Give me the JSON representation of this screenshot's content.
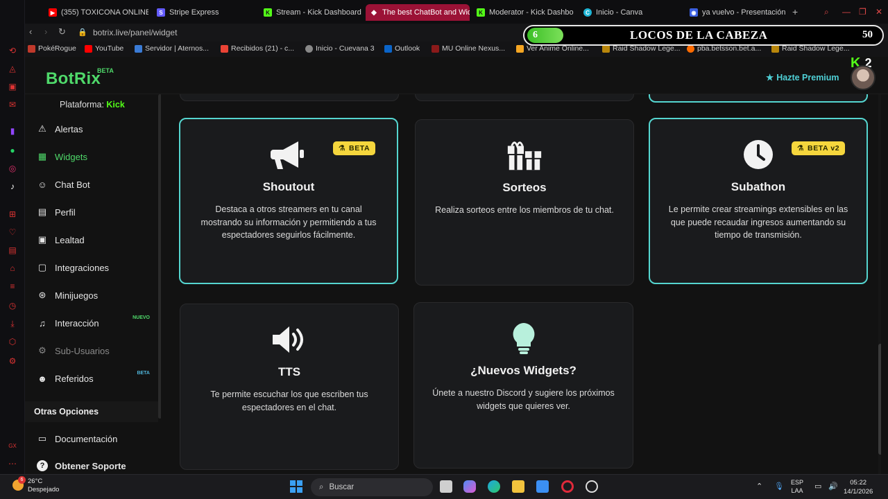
{
  "browser": {
    "tabs": [
      {
        "label": "(355) TOXICONA ONLINE",
        "favicon_color": "#ff0000",
        "favicon_glyph": "▶"
      },
      {
        "label": "Stripe Express",
        "favicon_color": "#635bff",
        "favicon_glyph": "S"
      },
      {
        "label": "Stream - Kick Dashboard",
        "favicon_color": "#53fc18",
        "favicon_glyph": "K"
      },
      {
        "label": "The best ChatBot and Wid",
        "favicon_color": "#ffffff",
        "favicon_glyph": "◆"
      },
      {
        "label": "Moderator - Kick Dashbo",
        "favicon_color": "#53fc18",
        "favicon_glyph": "K"
      },
      {
        "label": "Inicio - Canva",
        "favicon_color": "#1fb6d6",
        "favicon_glyph": "C"
      },
      {
        "label": "ya vuelvo - Presentación",
        "favicon_color": "#3b5fe0",
        "favicon_glyph": "◉"
      }
    ],
    "active_tab": 3,
    "url": "botrix.live/panel/widget",
    "bookmarks": [
      {
        "label": "PokéRogue",
        "color": "#c0392b"
      },
      {
        "label": "YouTube",
        "color": "#ff0000"
      },
      {
        "label": "Servidor | Aternos...",
        "color": "#3a7bd5"
      },
      {
        "label": "Recibidos (21) - c...",
        "color": "#ea4335"
      },
      {
        "label": "Inicio - Cuevana 3",
        "color": "#888888"
      },
      {
        "label": "Outlook",
        "color": "#0a64c8"
      },
      {
        "label": "MU Online Nexus...",
        "color": "#8b1a1a"
      },
      {
        "label": "Ver Anime Online...",
        "color": "#f5a623"
      },
      {
        "label": "Raid Shadow Lege...",
        "color": "#b8860b"
      },
      {
        "label": "pba.betsson.bet.a...",
        "color": "#ff6b00"
      },
      {
        "label": "Raid Shadow Lege...",
        "color": "#b8860b"
      }
    ]
  },
  "stream_overlay": {
    "count": "6",
    "title": "LOCOS DE LA CABEZA",
    "number": "50",
    "kick_count": "2"
  },
  "app": {
    "logo": "BotRix",
    "logo_badge": "BETA",
    "premium_label": "Hazte Premium",
    "platform_label": "Plataforma:",
    "platform_value": "Kick",
    "accent": "#4fd96a",
    "highlight_border": "#55d6d0"
  },
  "sidebar": {
    "items": [
      {
        "label": "Alertas",
        "icon": "alert-triangle-icon",
        "glyph": "⚠",
        "state": "normal",
        "tag": ""
      },
      {
        "label": "Widgets",
        "icon": "grid-icon",
        "glyph": "▦",
        "state": "active",
        "tag": ""
      },
      {
        "label": "Chat Bot",
        "icon": "robot-icon",
        "glyph": "☺",
        "state": "normal",
        "tag": ""
      },
      {
        "label": "Perfil",
        "icon": "id-card-icon",
        "glyph": "▤",
        "state": "normal",
        "tag": ""
      },
      {
        "label": "Lealtad",
        "icon": "calendar-icon",
        "glyph": "▣",
        "state": "normal",
        "tag": ""
      },
      {
        "label": "Integraciones",
        "icon": "window-icon",
        "glyph": "▢",
        "state": "normal",
        "tag": ""
      },
      {
        "label": "Minijuegos",
        "icon": "gamepad-icon",
        "glyph": "⊛",
        "state": "normal",
        "tag": ""
      },
      {
        "label": "Interacción",
        "icon": "music-note-icon",
        "glyph": "♫",
        "state": "normal",
        "tag": "NUEVO"
      },
      {
        "label": "Sub-Usuarios",
        "icon": "users-cog-icon",
        "glyph": "⚙",
        "state": "disabled",
        "tag": ""
      },
      {
        "label": "Referidos",
        "icon": "users-icon",
        "glyph": "☻",
        "state": "normal",
        "tag": "BETA"
      }
    ],
    "section_title": "Otras Opciones",
    "other_items": [
      {
        "label": "Documentación",
        "icon": "scroll-icon",
        "glyph": "▭"
      },
      {
        "label": "Obtener Soporte",
        "icon": "question-circle-icon",
        "glyph": "?"
      }
    ]
  },
  "widgets": [
    {
      "title": "Shoutout",
      "desc": "Destaca a otros streamers en tu canal mostrando su información y permitiendo a tus espectadores seguirlos fácilmente.",
      "badge": "BETA",
      "icon": "megaphone-icon",
      "highlight": true
    },
    {
      "title": "Sorteos",
      "desc": "Realiza sorteos entre los miembros de tu chat.",
      "badge": "",
      "icon": "gifts-icon",
      "highlight": false
    },
    {
      "title": "Subathon",
      "desc": "Le permite crear streamings extensibles en las que puede recaudar ingresos aumentando su tiempo de transmisión.",
      "badge": "BETA v2",
      "icon": "clock-icon",
      "highlight": true
    },
    {
      "title": "TTS",
      "desc": "Te permite escuchar los que escriben tus espectadores en el chat.",
      "badge": "",
      "icon": "speaker-icon",
      "highlight": false
    },
    {
      "title": "¿Nuevos Widgets?",
      "desc": "Únete a nuestro Discord y sugiere los próximos widgets que quieres ver.",
      "badge": "",
      "icon": "lightbulb-icon",
      "highlight": false
    }
  ],
  "taskbar": {
    "weather_temp": "26°C",
    "weather_desc": "Despejado",
    "weather_badge": "6",
    "search_label": "Buscar",
    "lang_top": "ESP",
    "lang_bottom": "LAA",
    "time": "05:22",
    "date": "14/1/2026"
  }
}
